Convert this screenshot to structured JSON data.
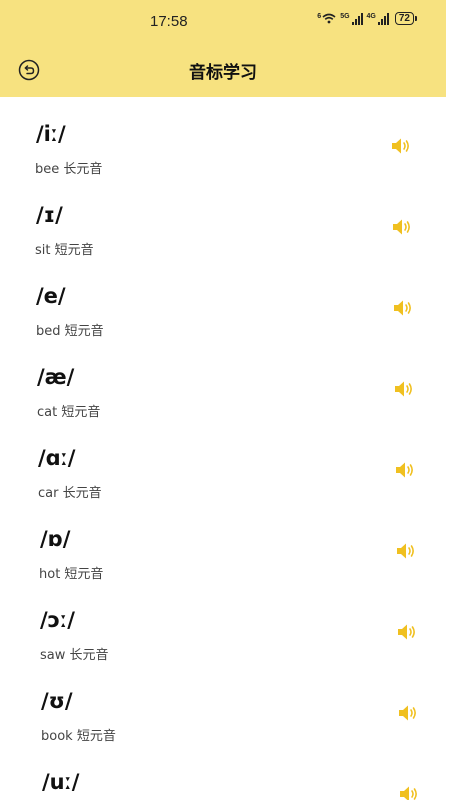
{
  "status_bar": {
    "time": "17:58",
    "wifi_label": "6",
    "sim1_label": "5G",
    "sim2_label": "4G",
    "battery": "72"
  },
  "header": {
    "title": "音标学习",
    "back_icon": "back-arrow-icon"
  },
  "colors": {
    "header_bg": "#f7e280",
    "speaker": "#f0c020"
  },
  "phonemes": [
    {
      "symbol": "/iː/",
      "example": "bee 长元音"
    },
    {
      "symbol": "/ɪ/",
      "example": "sit 短元音"
    },
    {
      "symbol": "/e/",
      "example": "bed 短元音"
    },
    {
      "symbol": "/æ/",
      "example": "cat 短元音"
    },
    {
      "symbol": "/ɑː/",
      "example": "car 长元音"
    },
    {
      "symbol": "/ɒ/",
      "example": "hot 短元音"
    },
    {
      "symbol": "/ɔː/",
      "example": "saw 长元音"
    },
    {
      "symbol": "/ʊ/",
      "example": "book 短元音"
    },
    {
      "symbol": "/uː/",
      "example": ""
    }
  ]
}
